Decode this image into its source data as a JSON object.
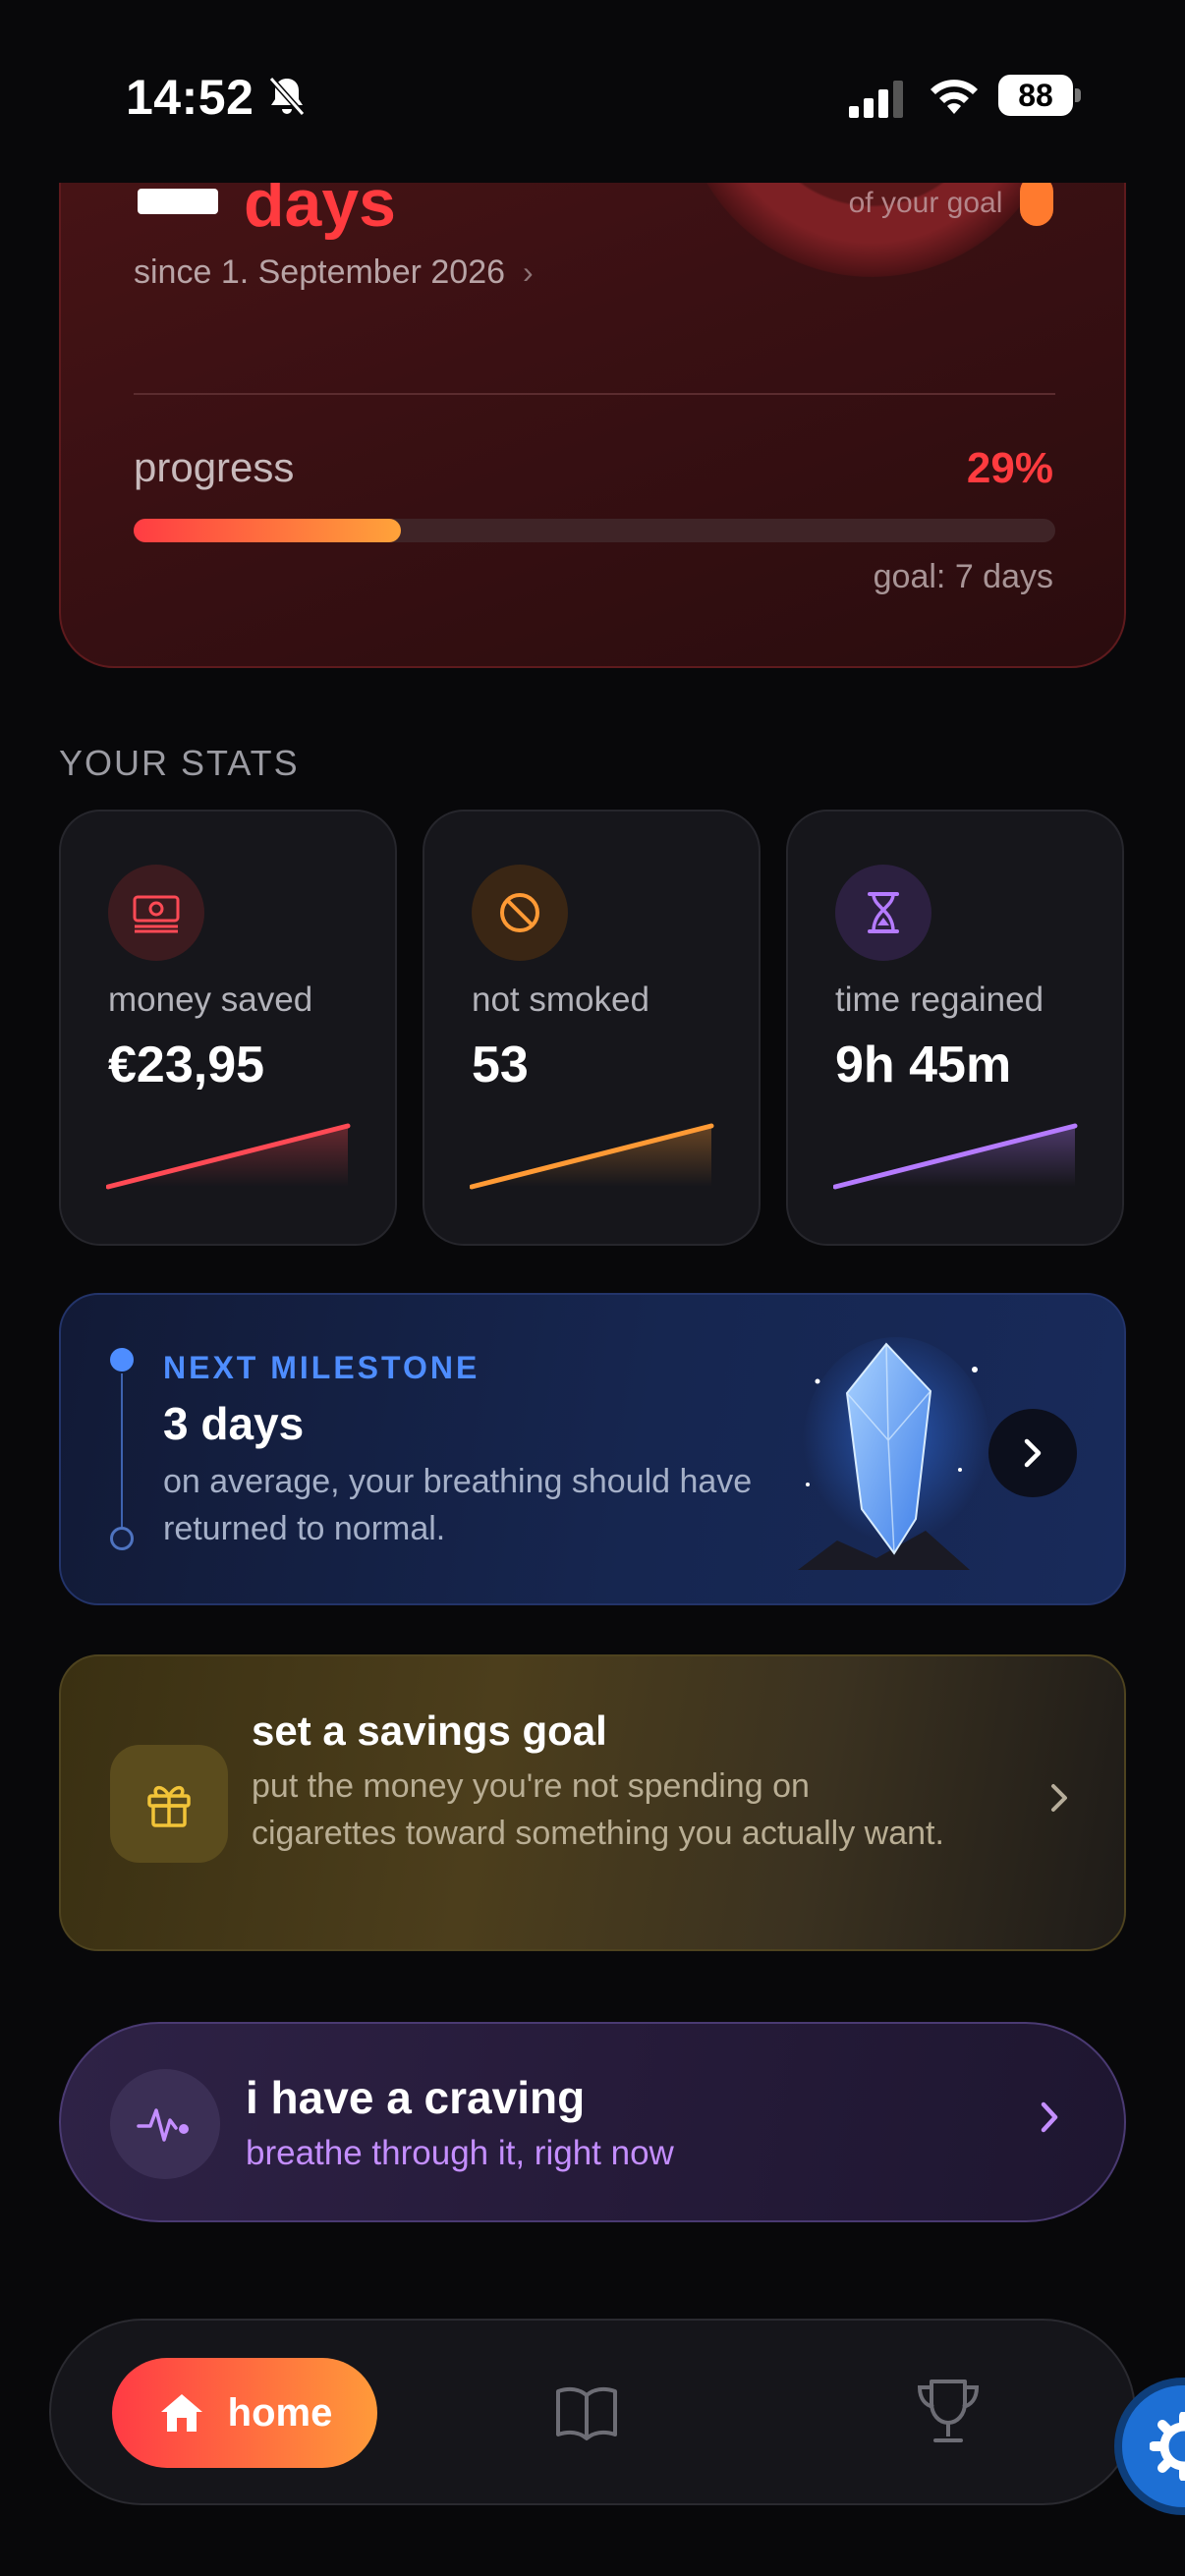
{
  "status_bar": {
    "time": "14:52",
    "battery": "88"
  },
  "hero": {
    "days_label": "days",
    "goal_caption": "of your goal",
    "since": "since 1. September 2026",
    "progress_label": "progress",
    "progress_percent": "29%",
    "progress_value": 0.29,
    "goal_text": "goal: 7 days"
  },
  "stats": {
    "section_title": "YOUR STATS",
    "items": [
      {
        "label": "money saved",
        "value": "€23,95",
        "icon": "money-icon",
        "color": "#ff4a55"
      },
      {
        "label": "not smoked",
        "value": "53",
        "icon": "no-smoking-icon",
        "color": "#ff9a35"
      },
      {
        "label": "time regained",
        "value": "9h 45m",
        "icon": "hourglass-icon",
        "color": "#b57bff"
      }
    ]
  },
  "milestone": {
    "kicker": "NEXT MILESTONE",
    "title": "3 days",
    "text": "on average, your breathing should have returned to normal."
  },
  "savings": {
    "title": "set a savings goal",
    "text": "put the money you're not spending on cigarettes toward something you actually want."
  },
  "craving": {
    "title": "i have a craving",
    "subtitle": "breathe through it, right now"
  },
  "nav": {
    "home_label": "home"
  },
  "colors": {
    "accent_red": "#ff3b3f",
    "accent_orange": "#ff9a3a",
    "accent_blue": "#4e8dff",
    "accent_purple": "#c48eff"
  }
}
